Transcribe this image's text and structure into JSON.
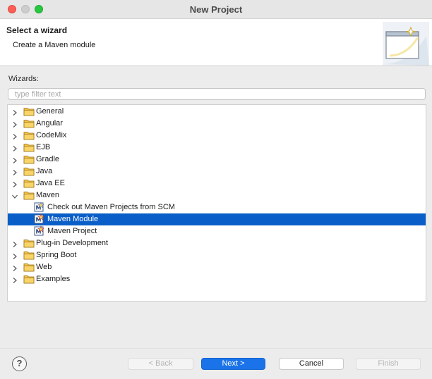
{
  "window": {
    "title": "New Project"
  },
  "banner": {
    "title": "Select a wizard",
    "description": "Create a Maven module"
  },
  "wizards_label": "Wizards:",
  "filter": {
    "placeholder": "type filter text",
    "value": ""
  },
  "tree": {
    "items": [
      {
        "label": "General",
        "expanded": false,
        "level": 0,
        "icon": "folder-icon"
      },
      {
        "label": "Angular",
        "expanded": false,
        "level": 0,
        "icon": "folder-icon"
      },
      {
        "label": "CodeMix",
        "expanded": false,
        "level": 0,
        "icon": "folder-icon"
      },
      {
        "label": "EJB",
        "expanded": false,
        "level": 0,
        "icon": "folder-icon"
      },
      {
        "label": "Gradle",
        "expanded": false,
        "level": 0,
        "icon": "folder-icon"
      },
      {
        "label": "Java",
        "expanded": false,
        "level": 0,
        "icon": "folder-icon"
      },
      {
        "label": "Java EE",
        "expanded": false,
        "level": 0,
        "icon": "folder-icon"
      },
      {
        "label": "Maven",
        "expanded": true,
        "level": 0,
        "icon": "folder-icon"
      },
      {
        "label": "Check out Maven Projects from SCM",
        "level": 1,
        "icon": "maven-checkout-icon"
      },
      {
        "label": "Maven Module",
        "level": 1,
        "icon": "maven-module-icon",
        "selected": true
      },
      {
        "label": "Maven Project",
        "level": 1,
        "icon": "maven-project-icon"
      },
      {
        "label": "Plug-in Development",
        "expanded": false,
        "level": 0,
        "icon": "folder-icon"
      },
      {
        "label": "Spring Boot",
        "expanded": false,
        "level": 0,
        "icon": "folder-icon"
      },
      {
        "label": "Web",
        "expanded": false,
        "level": 0,
        "icon": "folder-icon"
      },
      {
        "label": "Examples",
        "expanded": false,
        "level": 0,
        "icon": "folder-icon"
      }
    ]
  },
  "buttons": {
    "help": "?",
    "back": "< Back",
    "next": "Next >",
    "cancel": "Cancel",
    "finish": "Finish"
  },
  "colors": {
    "selection": "#0a5ec8",
    "primary_button": "#1a73e8",
    "folder": "#f2c04a"
  }
}
